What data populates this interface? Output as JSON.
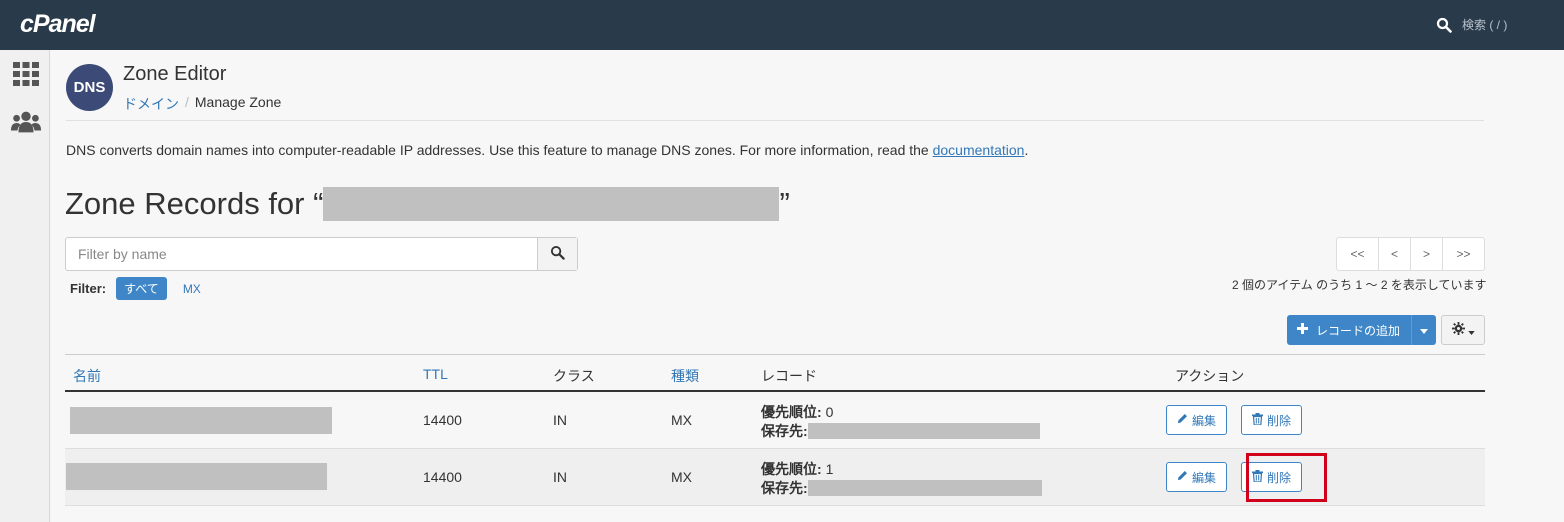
{
  "topbar": {
    "logo": "cPanel",
    "search_placeholder": "検索 ( / )"
  },
  "sidebar": {
    "icons": [
      "apps-grid-icon",
      "users-icon"
    ]
  },
  "header": {
    "logo_text": "DNS",
    "title": "Zone Editor",
    "breadcrumb": {
      "link": "ドメイン",
      "separator": "/",
      "current": "Manage Zone"
    }
  },
  "description": {
    "text": "DNS converts domain names into computer-readable IP addresses. Use this feature to manage DNS zones. For more information, read the ",
    "link": "documentation",
    "suffix": "."
  },
  "zone_heading": {
    "prefix": "Zone Records for “",
    "suffix": "”"
  },
  "filter": {
    "placeholder": "Filter by name",
    "label": "Filter:",
    "options": [
      "すべて",
      "MX"
    ],
    "active": "すべて"
  },
  "pagination": {
    "buttons": [
      "<<",
      "<",
      ">",
      ">>"
    ],
    "info": "2 個のアイテム のうち 1 ～ 2 を表示しています"
  },
  "toolbar": {
    "add_record_label": "レコードの追加"
  },
  "table": {
    "headers": [
      "名前",
      "TTL",
      "クラス",
      "種類",
      "レコード",
      "アクション"
    ],
    "rows": [
      {
        "name": "",
        "ttl": "14400",
        "class": "IN",
        "type": "MX",
        "priority_label": "優先順位:",
        "priority": "0",
        "destination_label": "保存先:",
        "destination": ""
      },
      {
        "name": "",
        "ttl": "14400",
        "class": "IN",
        "type": "MX",
        "priority_label": "優先順位:",
        "priority": "1",
        "destination_label": "保存先:",
        "destination": ""
      }
    ],
    "actions": {
      "edit_label": "編集",
      "delete_label": "削除"
    }
  },
  "colors": {
    "topbar": "#293a4a",
    "accent": "#3e86c8",
    "link": "#3278b7",
    "highlight": "#d0021b"
  }
}
